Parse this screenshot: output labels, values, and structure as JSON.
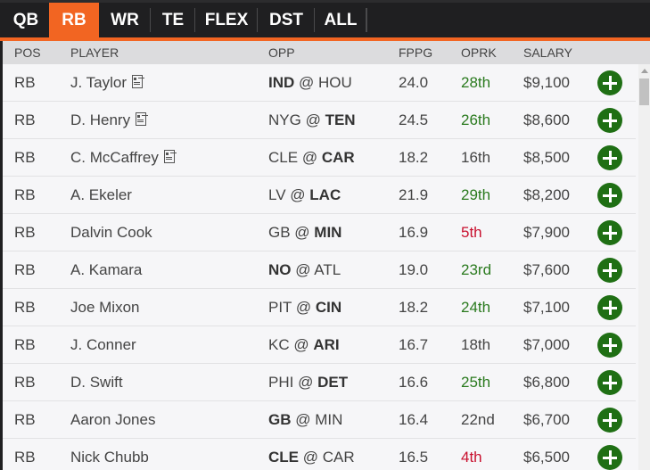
{
  "tabs": [
    {
      "label": "QB",
      "active": false
    },
    {
      "label": "RB",
      "active": true
    },
    {
      "label": "WR",
      "active": false
    },
    {
      "label": "TE",
      "active": false
    },
    {
      "label": "FLEX",
      "active": false
    },
    {
      "label": "DST",
      "active": false
    },
    {
      "label": "ALL",
      "active": false
    }
  ],
  "columns": {
    "pos": "POS",
    "player": "PLAYER",
    "opp": "OPP",
    "fppg": "FPPG",
    "oprk": "OPRK",
    "salary": "SALARY"
  },
  "colors": {
    "accent": "#f26522",
    "good_rank": "#2a7a1e",
    "bad_rank": "#c8102e",
    "add_button": "#1f6f14"
  },
  "players": [
    {
      "pos": "RB",
      "name": "J. Taylor",
      "news": true,
      "away": "IND",
      "home": "HOU",
      "team_side": "away",
      "fppg": "24.0",
      "oprk": "28th",
      "oprk_tone": "green",
      "salary": "$9,100"
    },
    {
      "pos": "RB",
      "name": "D. Henry",
      "news": true,
      "away": "NYG",
      "home": "TEN",
      "team_side": "home",
      "fppg": "24.5",
      "oprk": "26th",
      "oprk_tone": "green",
      "salary": "$8,600"
    },
    {
      "pos": "RB",
      "name": "C. McCaffrey",
      "news": true,
      "away": "CLE",
      "home": "CAR",
      "team_side": "home",
      "fppg": "18.2",
      "oprk": "16th",
      "oprk_tone": "neutral",
      "salary": "$8,500"
    },
    {
      "pos": "RB",
      "name": "A. Ekeler",
      "news": false,
      "away": "LV",
      "home": "LAC",
      "team_side": "home",
      "fppg": "21.9",
      "oprk": "29th",
      "oprk_tone": "green",
      "salary": "$8,200"
    },
    {
      "pos": "RB",
      "name": "Dalvin Cook",
      "news": false,
      "away": "GB",
      "home": "MIN",
      "team_side": "home",
      "fppg": "16.9",
      "oprk": "5th",
      "oprk_tone": "red",
      "salary": "$7,900"
    },
    {
      "pos": "RB",
      "name": "A. Kamara",
      "news": false,
      "away": "NO",
      "home": "ATL",
      "team_side": "away",
      "fppg": "19.0",
      "oprk": "23rd",
      "oprk_tone": "green",
      "salary": "$7,600"
    },
    {
      "pos": "RB",
      "name": "Joe Mixon",
      "news": false,
      "away": "PIT",
      "home": "CIN",
      "team_side": "home",
      "fppg": "18.2",
      "oprk": "24th",
      "oprk_tone": "green",
      "salary": "$7,100"
    },
    {
      "pos": "RB",
      "name": "J. Conner",
      "news": false,
      "away": "KC",
      "home": "ARI",
      "team_side": "home",
      "fppg": "16.7",
      "oprk": "18th",
      "oprk_tone": "neutral",
      "salary": "$7,000"
    },
    {
      "pos": "RB",
      "name": "D. Swift",
      "news": false,
      "away": "PHI",
      "home": "DET",
      "team_side": "home",
      "fppg": "16.6",
      "oprk": "25th",
      "oprk_tone": "green",
      "salary": "$6,800"
    },
    {
      "pos": "RB",
      "name": "Aaron Jones",
      "news": false,
      "away": "GB",
      "home": "MIN",
      "team_side": "away",
      "fppg": "16.4",
      "oprk": "22nd",
      "oprk_tone": "neutral",
      "salary": "$6,700"
    },
    {
      "pos": "RB",
      "name": "Nick Chubb",
      "news": false,
      "away": "CLE",
      "home": "CAR",
      "team_side": "away",
      "fppg": "16.5",
      "oprk": "4th",
      "oprk_tone": "red",
      "salary": "$6,500"
    }
  ],
  "opp_separator": "@"
}
